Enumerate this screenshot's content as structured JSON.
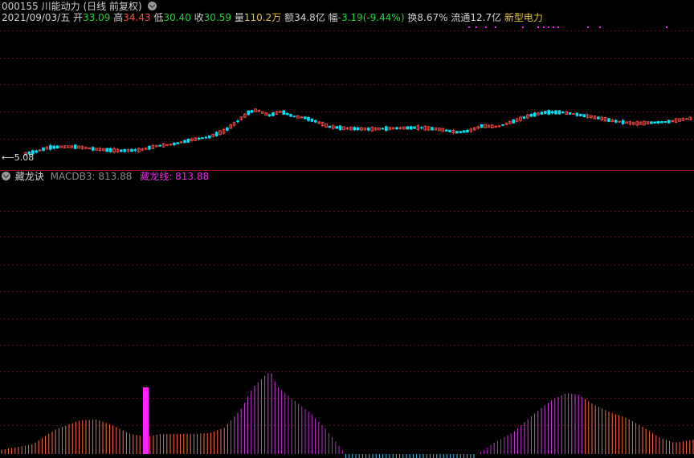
{
  "quote": {
    "code": "000155",
    "name": "川能动力",
    "mode": "(日线 前复权)",
    "date": "2021/09/03/五",
    "open_label": "开",
    "open": "33.09",
    "high_label": "高",
    "high": "34.43",
    "low_label": "低",
    "low": "30.40",
    "close_label": "收",
    "close": "30.59",
    "volume_label": "量",
    "volume": "110.2万",
    "amount_label": "额",
    "amount": "34.8亿",
    "change_label": "幅",
    "change": "-3.19(-9.44%)",
    "turnover_label": "换",
    "turnover": "8.67%",
    "float_label": "流通",
    "float": "12.7亿",
    "sector": "新型电力"
  },
  "price_min_label": "5.08",
  "indicator": {
    "name": "藏龙诀",
    "line1_label": "MACDB3:",
    "line1_value": "813.88",
    "line2_label": "藏龙线:",
    "line2_value": "813.88"
  },
  "colors": {
    "up": "#ff4a4a",
    "down": "#00e0f0",
    "magenta": "#ff22ff",
    "divider": "#8a1818"
  }
}
